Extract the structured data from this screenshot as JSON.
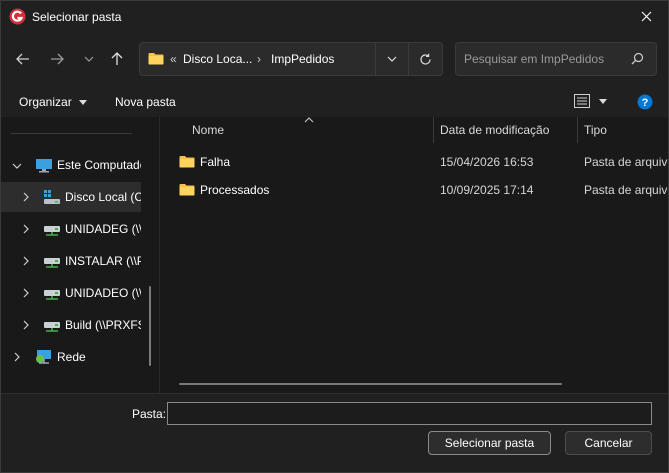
{
  "window": {
    "title": "Selecionar pasta"
  },
  "nav": {
    "address": {
      "overflow": "«",
      "crumbs": [
        "Disco Loca...",
        "ImpPedidos"
      ],
      "separator": "›"
    },
    "search": {
      "placeholder": "Pesquisar em ImpPedidos"
    }
  },
  "commandbar": {
    "organize_label": "Organizar",
    "new_folder_label": "Nova pasta"
  },
  "tree": {
    "items": [
      {
        "label": "Este Computador",
        "icon": "computer-icon",
        "expanded": true
      },
      {
        "label": "Disco Local (C:)",
        "icon": "drive-icon",
        "selected": true
      },
      {
        "label": "UNIDADEG (\\\\",
        "icon": "network-drive-icon"
      },
      {
        "label": "INSTALAR (\\\\P",
        "icon": "network-drive-icon"
      },
      {
        "label": "UNIDADEO (\\\\",
        "icon": "network-drive-icon"
      },
      {
        "label": "Build (\\\\PRXFS",
        "icon": "network-drive-icon"
      },
      {
        "label": "Rede",
        "icon": "network-icon"
      }
    ]
  },
  "filelist": {
    "columns": {
      "name": "Nome",
      "date": "Data de modificação",
      "type": "Tipo"
    },
    "rows": [
      {
        "name": "Falha",
        "date": "15/04/2026 16:53",
        "type": "Pasta de arquivos"
      },
      {
        "name": "Processados",
        "date": "10/09/2025 17:14",
        "type": "Pasta de arquivos"
      }
    ]
  },
  "footer": {
    "folder_label": "Pasta:",
    "folder_value": "",
    "select_label": "Selecionar pasta",
    "cancel_label": "Cancelar"
  },
  "colors": {
    "accent": "#0078d4",
    "folder": "#f4c04e",
    "background": "#191919",
    "panel": "#202020"
  }
}
